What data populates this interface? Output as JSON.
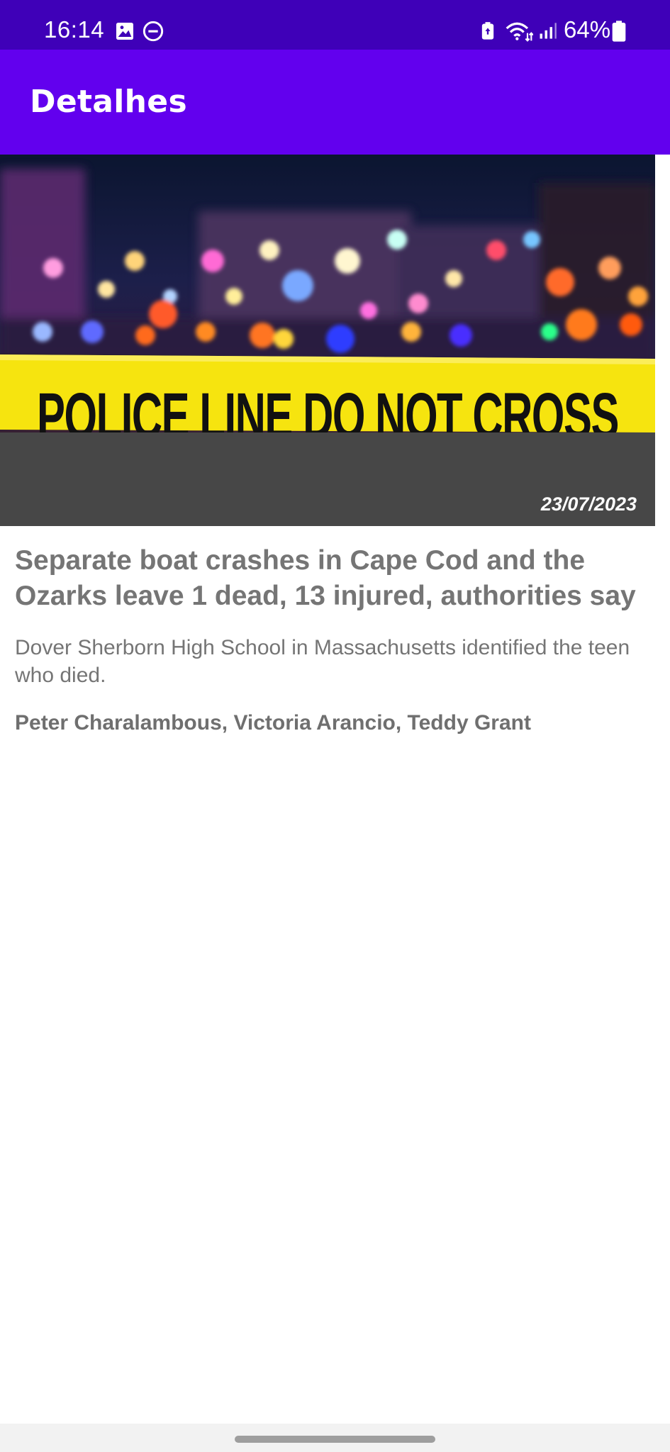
{
  "status_bar": {
    "time": "16:14",
    "battery_percent": "64%",
    "icons": [
      "gallery-icon",
      "do-not-disturb-icon",
      "battery-saver-icon",
      "wifi-icon",
      "signal-icon",
      "battery-icon"
    ]
  },
  "app_bar": {
    "title": "Detalhes"
  },
  "article": {
    "image": {
      "tape_text": "POLICE LINE DO NOT CROSS"
    },
    "date": "23/07/2023",
    "headline": "Separate boat crashes in Cape Cod and the Ozarks leave 1 dead, 13 injured, authorities say",
    "summary": "Dover Sherborn High School in Massachusetts identified the teen who died.",
    "authors": "Peter Charalambous, Victoria Arancio, Teddy Grant"
  },
  "colors": {
    "status_bar": "#3f00b8",
    "app_bar": "#6200ee",
    "image_panel": "#474747",
    "text_gray": "#757575",
    "tape_yellow": "#f6e40f"
  }
}
